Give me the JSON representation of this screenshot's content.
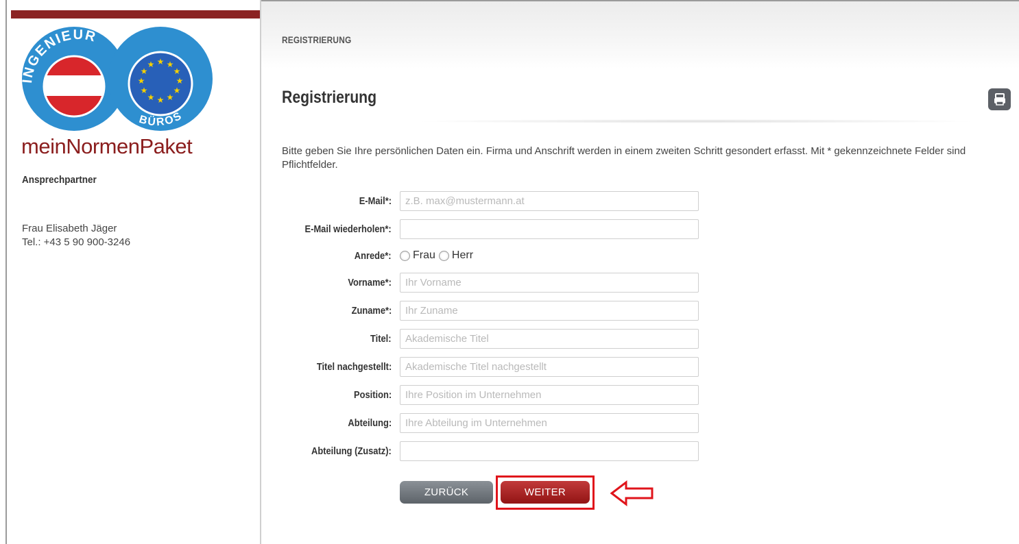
{
  "sidebar": {
    "logo": {
      "arc_top": "INGENIEUR",
      "arc_bottom": "BÜROS"
    },
    "brand": "meinNormenPaket",
    "contact_heading": "Ansprechpartner",
    "contact_name": "Frau Elisabeth Jäger",
    "contact_phone": "Tel.: +43 5 90 900-3246"
  },
  "header": {
    "breadcrumb": "REGISTRIERUNG"
  },
  "main": {
    "title": "Registrierung",
    "intro": "Bitte geben Sie Ihre persönlichen Daten ein. Firma und Anschrift werden in einem zweiten Schritt gesondert erfasst. Mit * gekennzeichnete Felder sind Pflichtfelder."
  },
  "form": {
    "email_label": "E-Mail*:",
    "email_placeholder": "z.B. max@mustermann.at",
    "email_repeat_label": "E-Mail wiederholen*:",
    "email_repeat_placeholder": "",
    "salutation_label": "Anrede*:",
    "salutation_options": [
      "Frau",
      "Herr"
    ],
    "firstname_label": "Vorname*:",
    "firstname_placeholder": "Ihr Vorname",
    "lastname_label": "Zuname*:",
    "lastname_placeholder": "Ihr Zuname",
    "title_label": "Titel:",
    "title_placeholder": "Akademische Titel",
    "title_after_label": "Titel nachgestellt:",
    "title_after_placeholder": "Akademische Titel nachgestellt",
    "position_label": "Position:",
    "position_placeholder": "Ihre Position im Unternehmen",
    "department_label": "Abteilung:",
    "department_placeholder": "Ihre Abteilung im Unternehmen",
    "department_extra_label": "Abteilung (Zusatz):",
    "department_extra_placeholder": ""
  },
  "buttons": {
    "back": "ZURÜCK",
    "next": "WEITER"
  },
  "colors": {
    "brand_red": "#8b1e1e",
    "logo_blue": "#2e8fd0",
    "next_button": "#b02525",
    "back_button": "#737a80",
    "highlight": "#e0141b",
    "eu_star": "#f5d000"
  },
  "icons": {
    "print": "printer-icon",
    "callout": "arrow-left-icon"
  }
}
